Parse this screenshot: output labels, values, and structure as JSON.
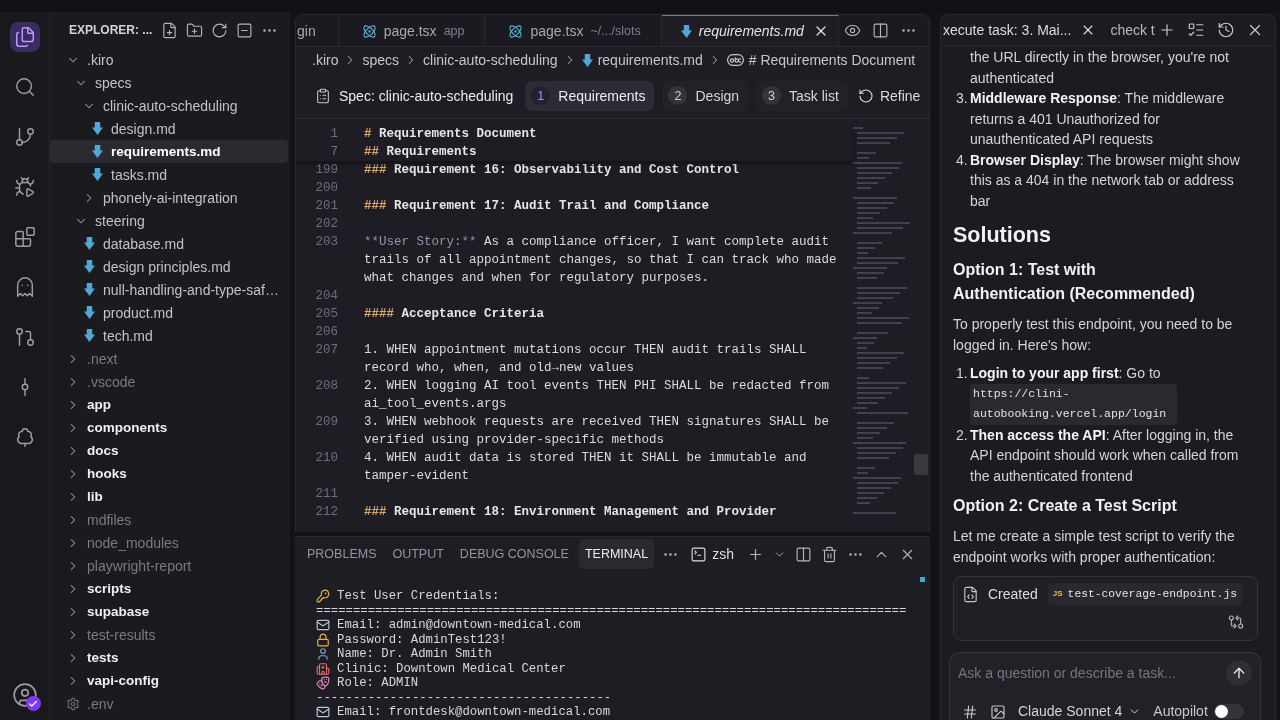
{
  "activity_bar": [
    {
      "kind": "explorer",
      "selected": true
    },
    {
      "kind": "search",
      "selected": false
    },
    {
      "kind": "git",
      "selected": false
    },
    {
      "kind": "debug",
      "selected": false
    },
    {
      "kind": "extensions",
      "selected": false
    },
    {
      "kind": "agent",
      "selected": false
    },
    {
      "kind": "graph",
      "selected": false
    },
    {
      "kind": "remote",
      "selected": false
    },
    {
      "kind": "tree",
      "selected": false
    }
  ],
  "account": {
    "badge": true
  },
  "explorer": {
    "title": "EXPLORER: ...",
    "tree": [
      {
        "name": ".kiro",
        "kind": "folder",
        "expanded": true,
        "selected": false,
        "dimmed": false,
        "bold": false,
        "children": [
          {
            "name": "specs",
            "kind": "folder",
            "expanded": true,
            "selected": false,
            "dimmed": false,
            "bold": false,
            "children": [
              {
                "name": "clinic-auto-scheduling",
                "kind": "folder",
                "expanded": true,
                "selected": false,
                "dimmed": false,
                "bold": false,
                "children": [
                  {
                    "name": "design.md",
                    "kind": "markdown",
                    "selected": false,
                    "dimmed": false,
                    "bold": false
                  },
                  {
                    "name": "requirements.md",
                    "kind": "markdown",
                    "selected": true,
                    "dimmed": false,
                    "bold": false
                  },
                  {
                    "name": "tasks.md",
                    "kind": "markdown",
                    "selected": false,
                    "dimmed": false,
                    "bold": false
                  }
                ]
              },
              {
                "name": "phonely-ai-integration",
                "kind": "folder",
                "expanded": false,
                "selected": false,
                "dimmed": false,
                "bold": false
              }
            ]
          },
          {
            "name": "steering",
            "kind": "folder",
            "expanded": true,
            "selected": false,
            "dimmed": false,
            "bold": false,
            "children": [
              {
                "name": "database.md",
                "kind": "markdown",
                "selected": false,
                "dimmed": false,
                "bold": false
              },
              {
                "name": "design principles.md",
                "kind": "markdown",
                "selected": false,
                "dimmed": false,
                "bold": false
              },
              {
                "name": "null-handling-and-type-saf…",
                "kind": "markdown",
                "selected": false,
                "dimmed": false,
                "bold": false
              },
              {
                "name": "product.md",
                "kind": "markdown",
                "selected": false,
                "dimmed": false,
                "bold": false
              },
              {
                "name": "tech.md",
                "kind": "markdown",
                "selected": false,
                "dimmed": false,
                "bold": false
              }
            ]
          }
        ]
      },
      {
        "name": ".next",
        "kind": "folder",
        "expanded": false,
        "selected": false,
        "dimmed": true,
        "bold": false
      },
      {
        "name": ".vscode",
        "kind": "folder",
        "expanded": false,
        "selected": false,
        "dimmed": true,
        "bold": false
      },
      {
        "name": "app",
        "kind": "folder",
        "expanded": false,
        "selected": false,
        "dimmed": false,
        "bold": true
      },
      {
        "name": "components",
        "kind": "folder",
        "expanded": false,
        "selected": false,
        "dimmed": false,
        "bold": true
      },
      {
        "name": "docs",
        "kind": "folder",
        "expanded": false,
        "selected": false,
        "dimmed": false,
        "bold": true
      },
      {
        "name": "hooks",
        "kind": "folder",
        "expanded": false,
        "selected": false,
        "dimmed": false,
        "bold": true
      },
      {
        "name": "lib",
        "kind": "folder",
        "expanded": false,
        "selected": false,
        "dimmed": false,
        "bold": true
      },
      {
        "name": "mdfiles",
        "kind": "folder",
        "expanded": false,
        "selected": false,
        "dimmed": true,
        "bold": false
      },
      {
        "name": "node_modules",
        "kind": "folder",
        "expanded": false,
        "selected": false,
        "dimmed": true,
        "bold": false
      },
      {
        "name": "playwright-report",
        "kind": "folder",
        "expanded": false,
        "selected": false,
        "dimmed": true,
        "bold": false
      },
      {
        "name": "scripts",
        "kind": "folder",
        "expanded": false,
        "selected": false,
        "dimmed": false,
        "bold": true
      },
      {
        "name": "supabase",
        "kind": "folder",
        "expanded": false,
        "selected": false,
        "dimmed": false,
        "bold": true
      },
      {
        "name": "test-results",
        "kind": "folder",
        "expanded": false,
        "selected": false,
        "dimmed": true,
        "bold": false
      },
      {
        "name": "tests",
        "kind": "folder",
        "expanded": false,
        "selected": false,
        "dimmed": false,
        "bold": true
      },
      {
        "name": "vapi-config",
        "kind": "folder",
        "expanded": false,
        "selected": false,
        "dimmed": false,
        "bold": true
      },
      {
        "name": ".env",
        "kind": "config",
        "selected": false,
        "dimmed": true,
        "bold": false
      }
    ]
  },
  "editor": {
    "tabs": [
      {
        "label": "gin",
        "selected": false,
        "preview": false
      },
      {
        "label": "page.tsx",
        "detail": "app",
        "kind": "react",
        "selected": false,
        "preview": false
      },
      {
        "label": "page.tsx",
        "detail": "~/.../slots",
        "kind": "react",
        "selected": false,
        "preview": false
      },
      {
        "label": "requirements.md",
        "kind": "markdown",
        "selected": true,
        "preview": true
      }
    ],
    "breadcrumb": [
      {
        "label": ".kiro",
        "kind": "folder"
      },
      {
        "label": "specs",
        "kind": "folder"
      },
      {
        "label": "clinic-auto-scheduling",
        "kind": "folder"
      },
      {
        "label": "requirements.md",
        "kind": "markdown"
      },
      {
        "label": "# Requirements Document",
        "kind": "symbol"
      }
    ],
    "spec": {
      "title": "Spec: clinic-auto-scheduling",
      "steps": [
        {
          "number": "1",
          "label": "Requirements",
          "selected": true
        },
        {
          "number": "2",
          "label": "Design",
          "selected": false
        },
        {
          "number": "3",
          "label": "Task list",
          "selected": false
        }
      ],
      "refine": "Refine"
    },
    "sticky_lines": [
      {
        "number": "1",
        "kind": "heading",
        "marker": "#",
        "text": "Requirements Document"
      },
      {
        "number": "7",
        "kind": "heading",
        "marker": "##",
        "text": "Requirements"
      }
    ],
    "lines": [
      {
        "number": "199",
        "kind": "heading",
        "marker": "###",
        "text": "Requirement 16: Observability and Cost Control"
      },
      {
        "number": "200",
        "kind": "blank"
      },
      {
        "number": "201",
        "kind": "heading",
        "marker": "###",
        "text": "Requirement 17: Audit Trail and Compliance"
      },
      {
        "number": "202",
        "kind": "blank"
      },
      {
        "number": "203",
        "kind": "story",
        "marker": "**User Story:**",
        "text": "As a compliance officer, I want complete audit trails of all appointment changes, so that I can track who made what changes and when for regulatory purposes."
      },
      {
        "number": "204",
        "kind": "blank"
      },
      {
        "number": "205",
        "kind": "heading",
        "marker": "####",
        "text": "Acceptance Criteria"
      },
      {
        "number": "206",
        "kind": "blank"
      },
      {
        "number": "207",
        "kind": "text",
        "text": "1. WHEN appointment mutations occur THEN audit trails SHALL record who, when, and old→new values"
      },
      {
        "number": "208",
        "kind": "text",
        "text": "2. WHEN logging AI tool events THEN PHI SHALL be redacted from ai_tool_events.args"
      },
      {
        "number": "209",
        "kind": "text",
        "text": "3. WHEN webhook requests are received THEN signatures SHALL be verified using provider-specific methods"
      },
      {
        "number": "210",
        "kind": "text",
        "text": "4. WHEN audit data is stored THEN it SHALL be immutable and tamper-evident"
      },
      {
        "number": "211",
        "kind": "blank"
      },
      {
        "number": "212",
        "kind": "heading",
        "marker": "###",
        "text": "Requirement 18: Environment Management and Provider"
      }
    ]
  },
  "panel": {
    "tabs": [
      {
        "label": "PROBLEMS",
        "selected": false
      },
      {
        "label": "OUTPUT",
        "selected": false
      },
      {
        "label": "DEBUG CONSOLE",
        "selected": false
      },
      {
        "label": "TERMINAL",
        "selected": true
      }
    ],
    "shell": "zsh",
    "lines": [
      {
        "kind": "title",
        "text": "Test User Credentials:"
      },
      {
        "kind": "rule",
        "text": "================================================================================"
      },
      {
        "kind": "email",
        "text": "Email: admin@downtown-medical.com"
      },
      {
        "kind": "password",
        "text": "Password: AdminTest123!"
      },
      {
        "kind": "name",
        "text": "Name: Dr. Admin Smith"
      },
      {
        "kind": "clinic",
        "text": "Clinic: Downtown Medical Center"
      },
      {
        "kind": "role",
        "text": "Role: ADMIN"
      },
      {
        "kind": "rule",
        "text": "----------------------------------------"
      },
      {
        "kind": "email",
        "text": "Email: frontdesk@downtown-medical.com"
      }
    ]
  },
  "chat": {
    "tabs": [
      {
        "label": "xecute task: 3. Mai...",
        "selected": true
      },
      {
        "label": "check t",
        "selected": false
      }
    ],
    "blocks": [
      {
        "kind": "list",
        "items": [
          {
            "text": "the URL directly in the browser, you're not authenticated"
          },
          {
            "number": "3.",
            "text": "**Middleware Response**: The middleware returns a 401 Unauthorized for unauthenticated API requests"
          },
          {
            "number": "4.",
            "text": "**Browser Display**: The browser might show this as a 404 in the network tab or address bar"
          }
        ]
      },
      {
        "kind": "h2",
        "text": "Solutions"
      },
      {
        "kind": "h3",
        "text": "Option 1: Test with Authentication (Recommended)"
      },
      {
        "kind": "paragraph",
        "text": "To properly test this endpoint, you need to be logged in. Here's how:"
      },
      {
        "kind": "list",
        "items": [
          {
            "number": "1.",
            "text": "**Login to your app first**: Go to",
            "code": "https://clini-autobooking.vercel.app/login"
          },
          {
            "number": "2.",
            "text": "**Then access the API**: After logging in, the API endpoint should work when called from the authenticated frontend"
          }
        ]
      },
      {
        "kind": "h3",
        "text": "Option 2: Create a Test Script"
      },
      {
        "kind": "paragraph",
        "text": "Let me create a simple test script to verify the endpoint works with proper authentication:"
      },
      {
        "kind": "file_card",
        "action": "Created",
        "badge": "JS",
        "file": "test-coverage-endpoint.js"
      }
    ],
    "input": {
      "placeholder": "Ask a question or describe a task..."
    },
    "model": "Claude Sonnet 4",
    "autopilot": {
      "label": "Autopilot",
      "on": false
    }
  }
}
